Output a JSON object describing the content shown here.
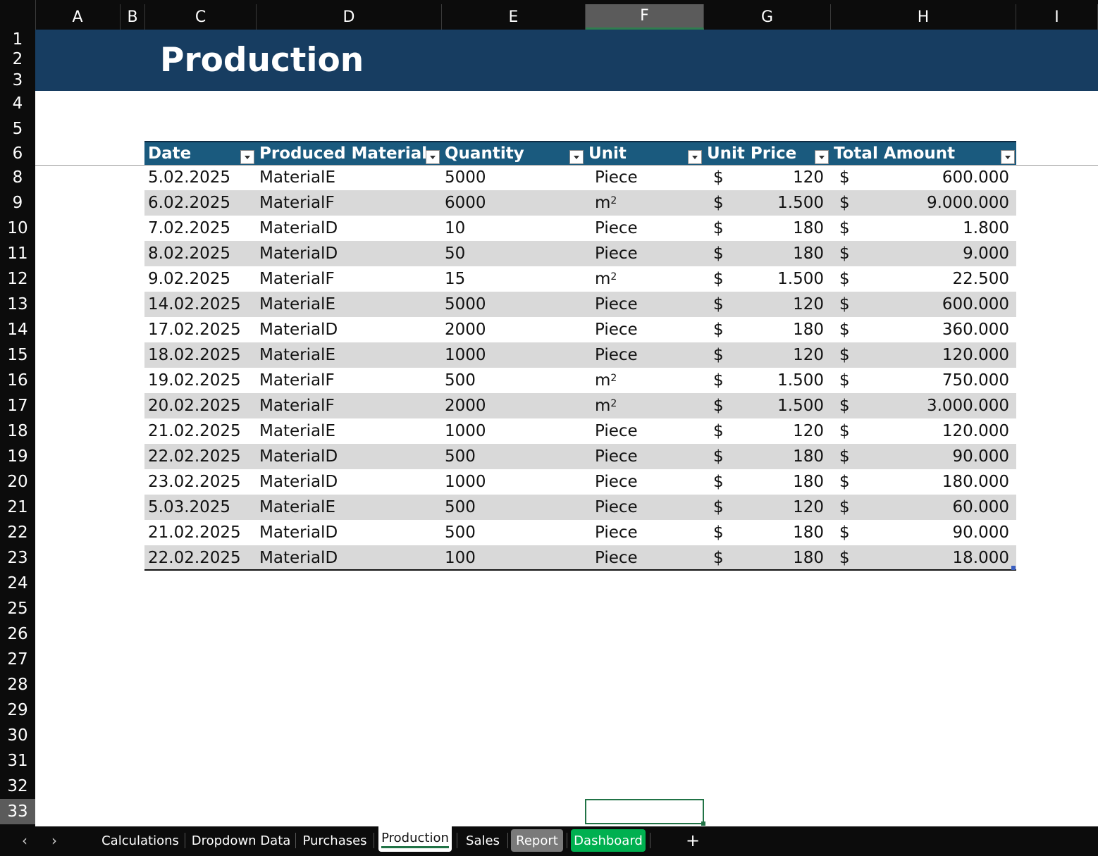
{
  "sheet_title": "Production",
  "columns": [
    "A",
    "B",
    "C",
    "D",
    "E",
    "F",
    "G",
    "H",
    "I"
  ],
  "active_column": "F",
  "rows": [
    "1",
    "2",
    "3",
    "4",
    "5",
    "6",
    "8",
    "9",
    "10",
    "11",
    "12",
    "13",
    "14",
    "15",
    "16",
    "17",
    "18",
    "19",
    "20",
    "21",
    "22",
    "23",
    "24",
    "25",
    "26",
    "27",
    "28",
    "29",
    "30",
    "31",
    "32",
    "33"
  ],
  "active_row": "33",
  "table": {
    "headers": [
      "Date",
      "Produced Material",
      "Quantity",
      "Unit",
      "Unit Price",
      "Total Amount"
    ],
    "currency_symbol": "$",
    "rows": [
      {
        "date": "5.02.2025",
        "material": "MaterialE",
        "quantity": "5000",
        "unit": "Piece",
        "unit_sup": "",
        "price": "120",
        "total": "600.000"
      },
      {
        "date": "6.02.2025",
        "material": "MaterialF",
        "quantity": "6000",
        "unit": "m",
        "unit_sup": "2",
        "price": "1.500",
        "total": "9.000.000"
      },
      {
        "date": "7.02.2025",
        "material": "MaterialD",
        "quantity": "10",
        "unit": "Piece",
        "unit_sup": "",
        "price": "180",
        "total": "1.800"
      },
      {
        "date": "8.02.2025",
        "material": "MaterialD",
        "quantity": "50",
        "unit": "Piece",
        "unit_sup": "",
        "price": "180",
        "total": "9.000"
      },
      {
        "date": "9.02.2025",
        "material": "MaterialF",
        "quantity": "15",
        "unit": "m",
        "unit_sup": "2",
        "price": "1.500",
        "total": "22.500"
      },
      {
        "date": "14.02.2025",
        "material": "MaterialE",
        "quantity": "5000",
        "unit": "Piece",
        "unit_sup": "",
        "price": "120",
        "total": "600.000"
      },
      {
        "date": "17.02.2025",
        "material": "MaterialD",
        "quantity": "2000",
        "unit": "Piece",
        "unit_sup": "",
        "price": "180",
        "total": "360.000"
      },
      {
        "date": "18.02.2025",
        "material": "MaterialE",
        "quantity": "1000",
        "unit": "Piece",
        "unit_sup": "",
        "price": "120",
        "total": "120.000"
      },
      {
        "date": "19.02.2025",
        "material": "MaterialF",
        "quantity": "500",
        "unit": "m",
        "unit_sup": "2",
        "price": "1.500",
        "total": "750.000"
      },
      {
        "date": "20.02.2025",
        "material": "MaterialF",
        "quantity": "2000",
        "unit": "m",
        "unit_sup": "2",
        "price": "1.500",
        "total": "3.000.000"
      },
      {
        "date": "21.02.2025",
        "material": "MaterialE",
        "quantity": "1000",
        "unit": "Piece",
        "unit_sup": "",
        "price": "120",
        "total": "120.000"
      },
      {
        "date": "22.02.2025",
        "material": "MaterialD",
        "quantity": "500",
        "unit": "Piece",
        "unit_sup": "",
        "price": "180",
        "total": "90.000"
      },
      {
        "date": "23.02.2025",
        "material": "MaterialD",
        "quantity": "1000",
        "unit": "Piece",
        "unit_sup": "",
        "price": "180",
        "total": "180.000"
      },
      {
        "date": "5.03.2025",
        "material": "MaterialE",
        "quantity": "500",
        "unit": "Piece",
        "unit_sup": "",
        "price": "120",
        "total": "60.000"
      },
      {
        "date": "21.02.2025",
        "material": "MaterialD",
        "quantity": "500",
        "unit": "Piece",
        "unit_sup": "",
        "price": "180",
        "total": "90.000"
      },
      {
        "date": "22.02.2025",
        "material": "MaterialD",
        "quantity": "100",
        "unit": "Piece",
        "unit_sup": "",
        "price": "180",
        "total": "18.000"
      }
    ]
  },
  "sheet_tabs": [
    {
      "label": "Calculations",
      "style": "normal"
    },
    {
      "label": "Dropdown Data",
      "style": "normal"
    },
    {
      "label": "Purchases",
      "style": "normal"
    },
    {
      "label": "Production",
      "style": "active"
    },
    {
      "label": "Sales",
      "style": "normal"
    },
    {
      "label": "Report",
      "style": "gray"
    },
    {
      "label": "Dashboard",
      "style": "green"
    }
  ],
  "tab_colors": {
    "report": "#7a7a7a",
    "dashboard": "#00b050",
    "banner": "#173d61",
    "table_header": "#1a5a7e"
  },
  "icons": {
    "prev": "chevron-left-icon",
    "next": "chevron-right-icon",
    "add": "plus-icon",
    "filter": "filter-dropdown-icon"
  },
  "nav": {
    "prev": "‹",
    "next": "›",
    "add": "+"
  }
}
